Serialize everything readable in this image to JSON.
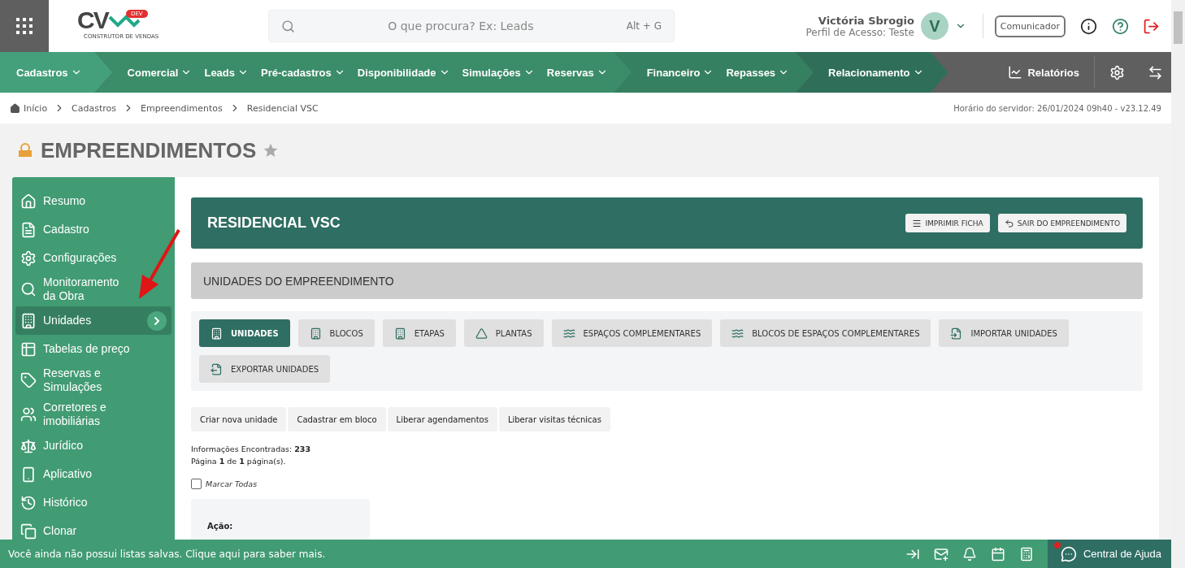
{
  "header": {
    "logo_text": "CV",
    "logo_badge": "DEV",
    "logo_tagline": "CONSTRUTOR DE VENDAS",
    "search": {
      "placeholder": "O que procura? Ex: Leads",
      "shortcut": "Alt + G"
    },
    "user": {
      "name": "Victória Sbrogio",
      "profile": "Perfil de Acesso: Teste",
      "initial": "V"
    },
    "communicator_button": "Comunicador"
  },
  "nav": {
    "groups": [
      {
        "color": "#44a07a",
        "items": [
          "Cadastros"
        ]
      },
      {
        "color": "#3b8c69",
        "items": [
          "Comercial",
          "Leads",
          "Pré-cadastros",
          "Disponibilidade",
          "Simulações",
          "Reservas"
        ]
      },
      {
        "color": "#358060",
        "items": [
          "Financeiro",
          "Repasses"
        ]
      },
      {
        "color": "#2f6f59",
        "items": [
          "Relacionamento"
        ]
      }
    ],
    "reports": "Relatórios"
  },
  "breadcrumb": [
    "Início",
    "Cadastros",
    "Empreendimentos",
    "Residencial VSC"
  ],
  "server_time": "Horário do servidor: 26/01/2024 09h40 - v23.12.49",
  "page_title": "EMPREENDIMENTOS",
  "sidebar": {
    "items": [
      {
        "label": "Resumo",
        "selected": false
      },
      {
        "label": "Cadastro",
        "selected": false
      },
      {
        "label": "Configurações",
        "selected": false
      },
      {
        "label": "Monitoramento da Obra",
        "selected": false
      },
      {
        "label": "Unidades",
        "selected": true
      },
      {
        "label": "Tabelas de preço",
        "selected": false
      },
      {
        "label": "Reservas e Simulações",
        "selected": false
      },
      {
        "label": "Corretores e imobiliárias",
        "selected": false
      },
      {
        "label": "Jurídico",
        "selected": false
      },
      {
        "label": "Aplicativo",
        "selected": false
      },
      {
        "label": "Histórico",
        "selected": false
      },
      {
        "label": "Clonar",
        "selected": false
      }
    ]
  },
  "project": {
    "title": "RESIDENCIAL VSC",
    "buttons": [
      "IMPRIMIR FICHA",
      "SAIR DO EMPREENDIMENTO"
    ]
  },
  "section_title": "UNIDADES DO EMPREENDIMENTO",
  "tabs": [
    {
      "label": "UNIDADES",
      "selected": true
    },
    {
      "label": "BLOCOS",
      "selected": false
    },
    {
      "label": "ETAPAS",
      "selected": false
    },
    {
      "label": "PLANTAS",
      "selected": false
    },
    {
      "label": "ESPAÇOS COMPLEMENTARES",
      "selected": false
    },
    {
      "label": "BLOCOS DE ESPAÇOS COMPLEMENTARES",
      "selected": false
    },
    {
      "label": "IMPORTAR UNIDADES",
      "selected": false
    },
    {
      "label": "EXPORTAR UNIDADES",
      "selected": false
    }
  ],
  "actions": [
    "Criar nova unidade",
    "Cadastrar em bloco",
    "Liberar agendamentos",
    "Liberar visitas técnicas"
  ],
  "info": [
    "Informações Encontradas: **233**",
    "Página **1** de **1** página(s)."
  ],
  "mark_all": {
    "label": "Marcar Todas",
    "checked": false
  },
  "action_panel": {
    "label": "Ação:"
  },
  "bottom_bar": {
    "message": "Você ainda não possui listas salvas. Clique aqui para saber mais.",
    "help": "Central de Ajuda",
    "help_notification": true
  }
}
